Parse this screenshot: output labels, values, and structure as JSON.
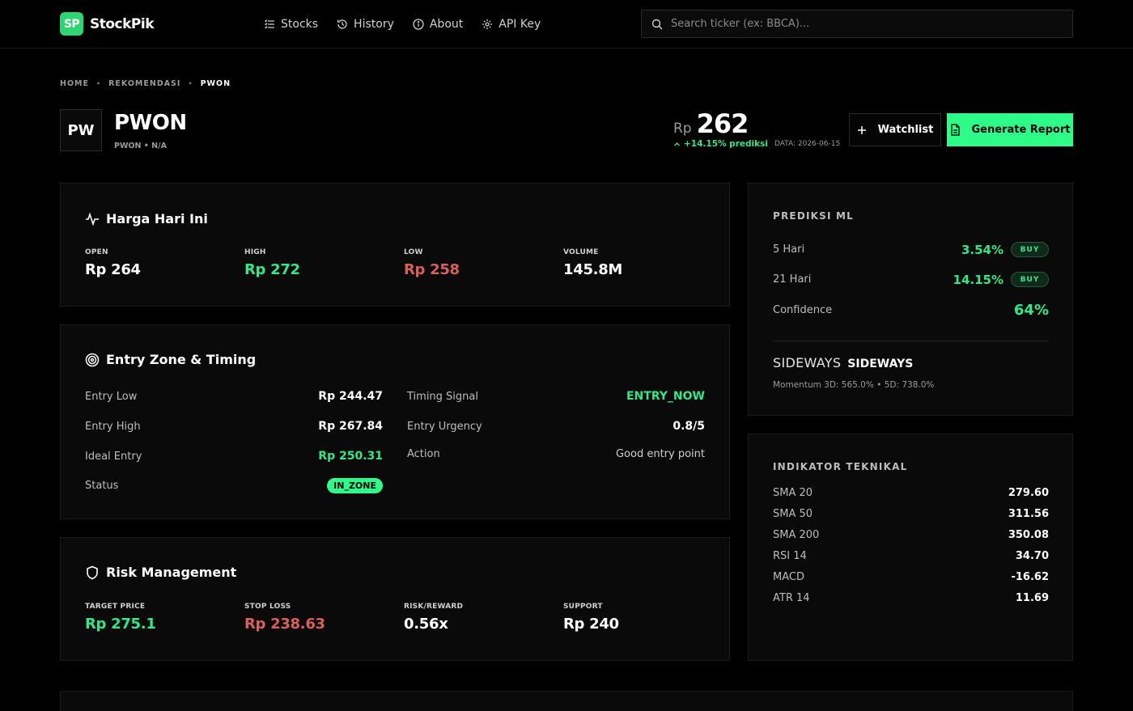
{
  "brand": {
    "badge": "SP",
    "name": "StockPik"
  },
  "nav": [
    {
      "label": "Stocks",
      "icon": "list-icon"
    },
    {
      "label": "History",
      "icon": "history-icon"
    },
    {
      "label": "About",
      "icon": "info-icon"
    },
    {
      "label": "API Key",
      "icon": "gear-icon"
    }
  ],
  "search": {
    "placeholder": "Search ticker (ex: BBCA)..."
  },
  "breadcrumb": [
    "HOME",
    "REKOMENDASI",
    "PWON"
  ],
  "header": {
    "badge": "PW",
    "ticker": "PWON",
    "subtitle": "PWON • N/A",
    "currency": "Rp",
    "price": "262",
    "change": "+14.15% prediksi",
    "date": "DATA: 2026-06-15",
    "watchlist_label": "Watchlist",
    "report_label": "Generate Report"
  },
  "today": {
    "title": "Harga Hari Ini",
    "stats": [
      {
        "label": "OPEN",
        "value": "Rp 264"
      },
      {
        "label": "HIGH",
        "value": "Rp 272"
      },
      {
        "label": "LOW",
        "value": "Rp 258"
      },
      {
        "label": "VOLUME",
        "value": "145.8M"
      }
    ]
  },
  "entry": {
    "title": "Entry Zone & Timing",
    "left": [
      {
        "label": "Entry Low",
        "value": "Rp 244.47"
      },
      {
        "label": "Entry High",
        "value": "Rp 267.84"
      },
      {
        "label": "Ideal Entry",
        "value": "Rp 250.31"
      },
      {
        "label": "Status",
        "value": "IN_ZONE"
      }
    ],
    "right": [
      {
        "label": "Timing Signal",
        "value": "ENTRY_NOW"
      },
      {
        "label": "Entry Urgency",
        "value": "0.8/5"
      },
      {
        "label": "Action",
        "value": "Good entry point"
      }
    ]
  },
  "risk": {
    "title": "Risk Management",
    "stats": [
      {
        "label": "TARGET PRICE",
        "value": "Rp 275.1"
      },
      {
        "label": "STOP LOSS",
        "value": "Rp 238.63"
      },
      {
        "label": "RISK/REWARD",
        "value": "0.56x"
      },
      {
        "label": "SUPPORT",
        "value": "Rp 240"
      }
    ]
  },
  "ml": {
    "title": "PREDIKSI ML",
    "rows": [
      {
        "label": "5 Hari",
        "value": "3.54%",
        "badge": "BUY"
      },
      {
        "label": "21 Hari",
        "value": "14.15%",
        "badge": "BUY"
      }
    ],
    "confidence_label": "Confidence",
    "confidence_value": "64%",
    "trend_a": "SIDEWAYS",
    "trend_b": "SIDEWAYS",
    "momentum": "Momentum 3D: 565.0% • 5D: 738.0%"
  },
  "indicators": {
    "title": "INDIKATOR TEKNIKAL",
    "rows": [
      {
        "label": "SMA 20",
        "value": "279.60"
      },
      {
        "label": "SMA 50",
        "value": "311.56"
      },
      {
        "label": "SMA 200",
        "value": "350.08"
      },
      {
        "label": "RSI 14",
        "value": "34.70"
      },
      {
        "label": "MACD",
        "value": "-16.62"
      },
      {
        "label": "ATR 14",
        "value": "11.69"
      }
    ]
  },
  "colors": {
    "accent": "#2efc88",
    "positive": "#2ee88a",
    "negative": "#d9605a",
    "background": "#000000"
  }
}
